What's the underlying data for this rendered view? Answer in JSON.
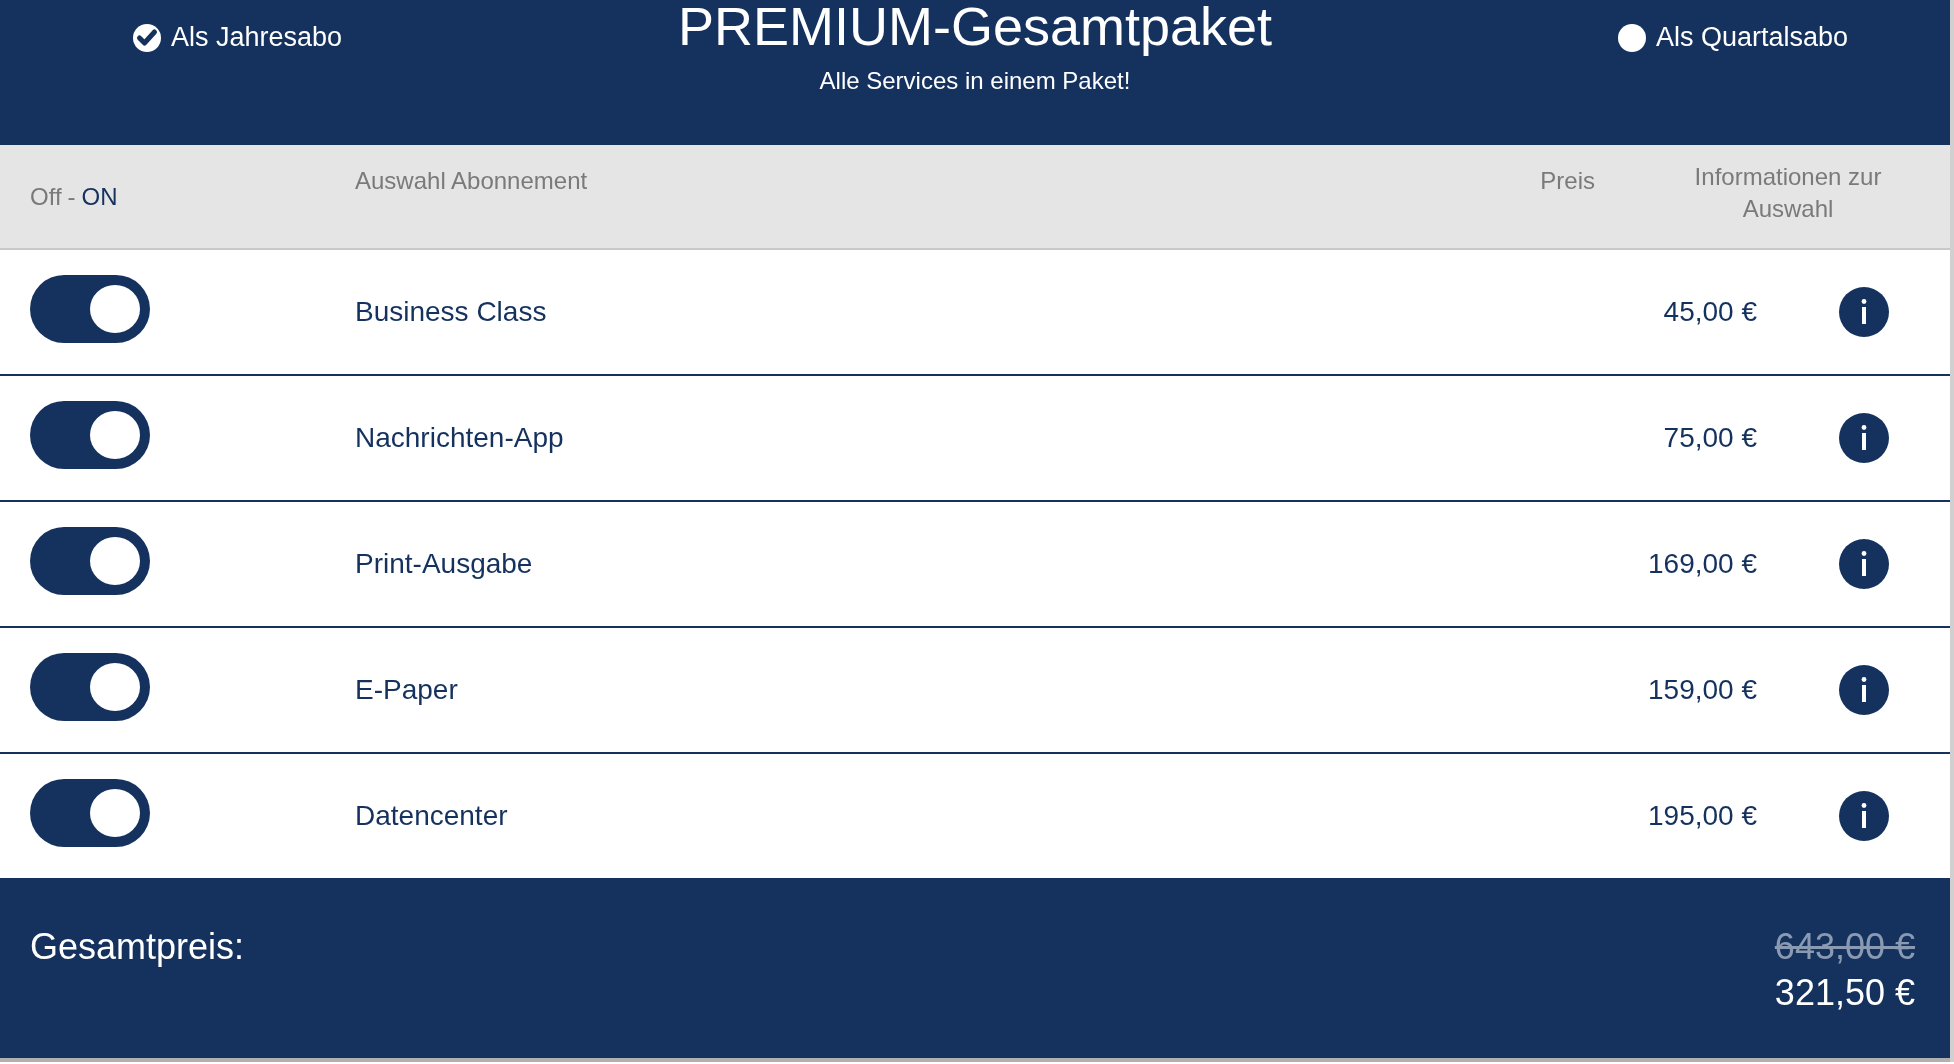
{
  "header": {
    "title": "PREMIUM-Gesamtpaket",
    "subtitle": "Alle Services in einem Paket!",
    "plans": [
      {
        "label": "Als Jahresabo",
        "selected": true
      },
      {
        "label": "Als Quartalsabo",
        "selected": false
      }
    ]
  },
  "table": {
    "columns": [
      {
        "kind": "toggle",
        "label_off": "Off",
        "separator": "-",
        "label_on": "ON"
      },
      {
        "kind": "name",
        "label": "Auswahl Abonnement"
      },
      {
        "kind": "price",
        "label": "Preis"
      },
      {
        "kind": "info",
        "label": "Informationen zur Auswahl"
      }
    ],
    "rows": [
      {
        "name": "Business Class",
        "price": "45,00 €",
        "on": true
      },
      {
        "name": "Nachrichten-App",
        "price": "75,00 €",
        "on": true
      },
      {
        "name": "Print-Ausgabe",
        "price": "169,00 €",
        "on": true
      },
      {
        "name": "E-Paper",
        "price": "159,00 €",
        "on": true
      },
      {
        "name": "Datencenter",
        "price": "195,00 €",
        "on": true
      }
    ]
  },
  "total": {
    "label": "Gesamtpreis:",
    "original_price": "643,00 €",
    "price": "321,50 €"
  }
}
